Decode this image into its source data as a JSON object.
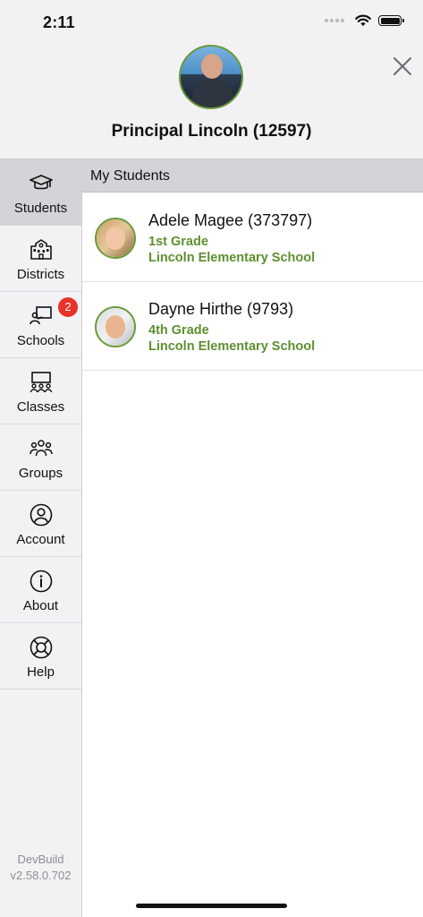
{
  "status_bar": {
    "time": "2:11"
  },
  "header": {
    "principal_name": "Principal Lincoln (12597)"
  },
  "sidebar": {
    "items": [
      {
        "label": "Students",
        "icon": "graduation-cap-icon",
        "active": true
      },
      {
        "label": "Districts",
        "icon": "building-icon",
        "active": false
      },
      {
        "label": "Schools",
        "icon": "teacher-board-icon",
        "active": false,
        "badge": "2"
      },
      {
        "label": "Classes",
        "icon": "classroom-icon",
        "active": false
      },
      {
        "label": "Groups",
        "icon": "people-group-icon",
        "active": false
      },
      {
        "label": "Account",
        "icon": "user-circle-icon",
        "active": false
      },
      {
        "label": "About",
        "icon": "info-icon",
        "active": false
      },
      {
        "label": "Help",
        "icon": "lifebuoy-icon",
        "active": false
      }
    ],
    "version_line1": "DevBuild",
    "version_line2": "v2.58.0.702"
  },
  "main": {
    "section_title": "My Students",
    "students": [
      {
        "name": "Adele Magee (373797)",
        "grade": "1st Grade",
        "school": "Lincoln Elementary School"
      },
      {
        "name": "Dayne Hirthe (9793)",
        "grade": "4th Grade",
        "school": "Lincoln Elementary School"
      }
    ]
  },
  "colors": {
    "accent_green": "#5e8f2f",
    "badge_red": "#e8322a",
    "active_bg": "#d4d4d8"
  }
}
